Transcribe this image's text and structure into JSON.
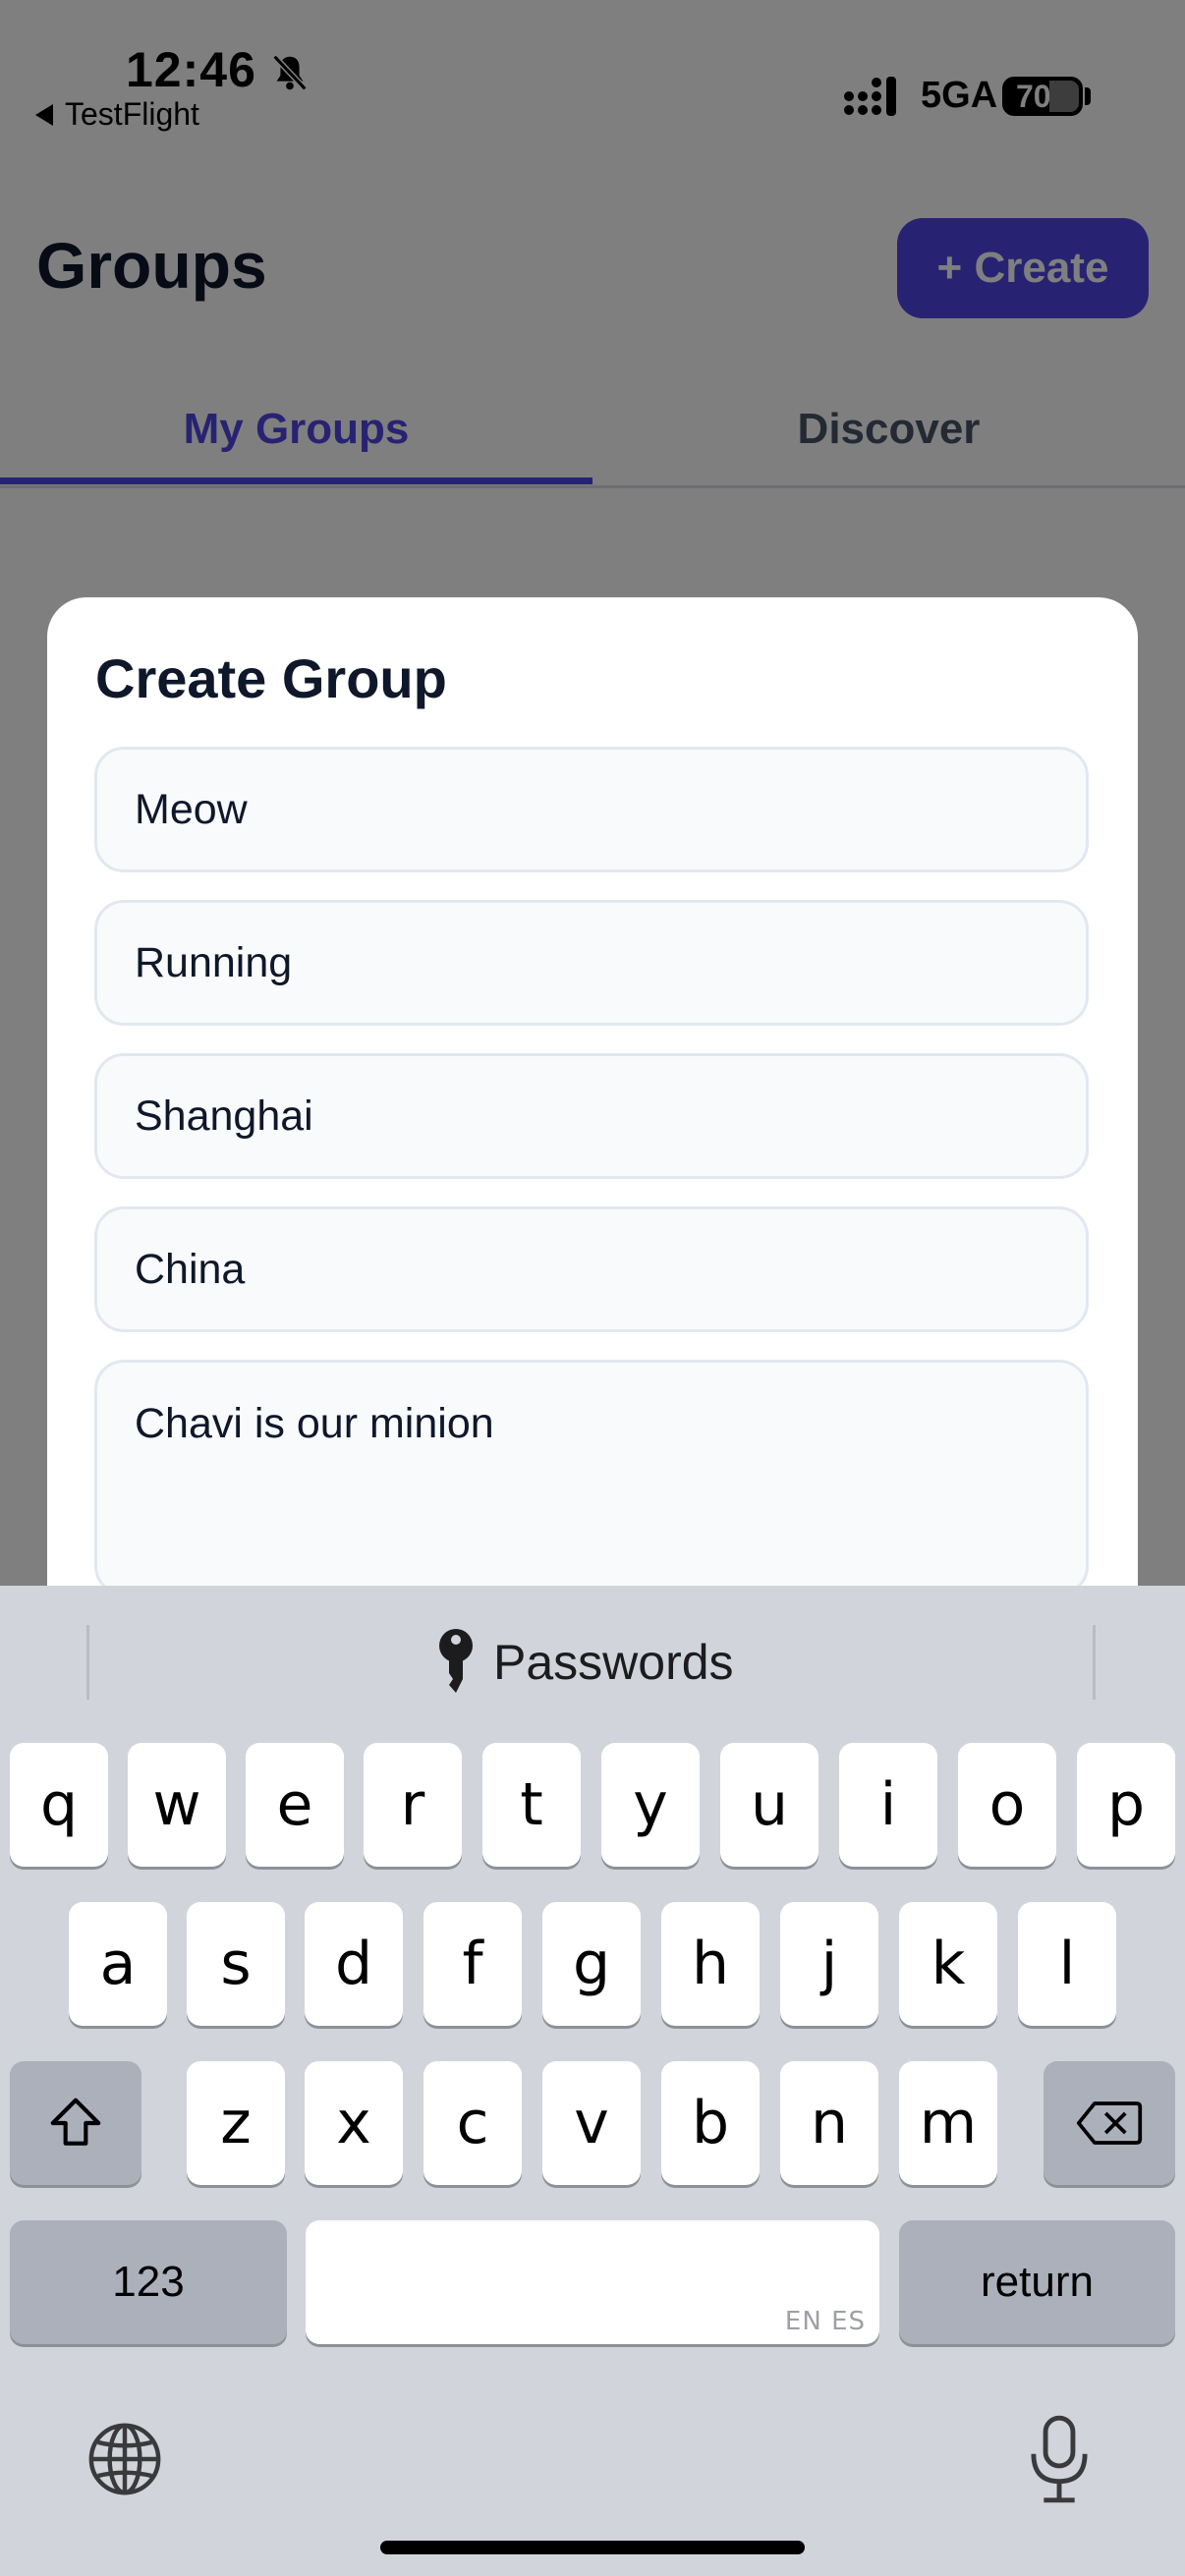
{
  "status_bar": {
    "time": "12:46",
    "back_app": "TestFlight",
    "network": "5GA",
    "battery": "70",
    "icons": [
      "bell-slash-icon",
      "signal-icon",
      "battery-icon"
    ]
  },
  "header": {
    "title": "Groups",
    "create_label": "+ Create",
    "accent": "#4f46e5"
  },
  "tabs": [
    {
      "label": "My Groups",
      "active": true
    },
    {
      "label": "Discover",
      "active": false
    }
  ],
  "modal": {
    "title": "Create Group",
    "fields": [
      {
        "value": "Meow"
      },
      {
        "value": "Running"
      },
      {
        "value": "Shanghai"
      },
      {
        "value": "China"
      },
      {
        "value": "Chavi is our minion"
      }
    ]
  },
  "keyboard": {
    "suggestion": "Passwords",
    "rows": [
      [
        "q",
        "w",
        "e",
        "r",
        "t",
        "y",
        "u",
        "i",
        "o",
        "p"
      ],
      [
        "a",
        "s",
        "d",
        "f",
        "g",
        "h",
        "j",
        "k",
        "l"
      ],
      [
        "z",
        "x",
        "c",
        "v",
        "b",
        "n",
        "m"
      ]
    ],
    "numbers_label": "123",
    "return_label": "return",
    "space_hint": "EN ES",
    "icons": [
      "key-icon",
      "shift-icon",
      "delete-icon",
      "globe-icon",
      "microphone-icon"
    ]
  }
}
